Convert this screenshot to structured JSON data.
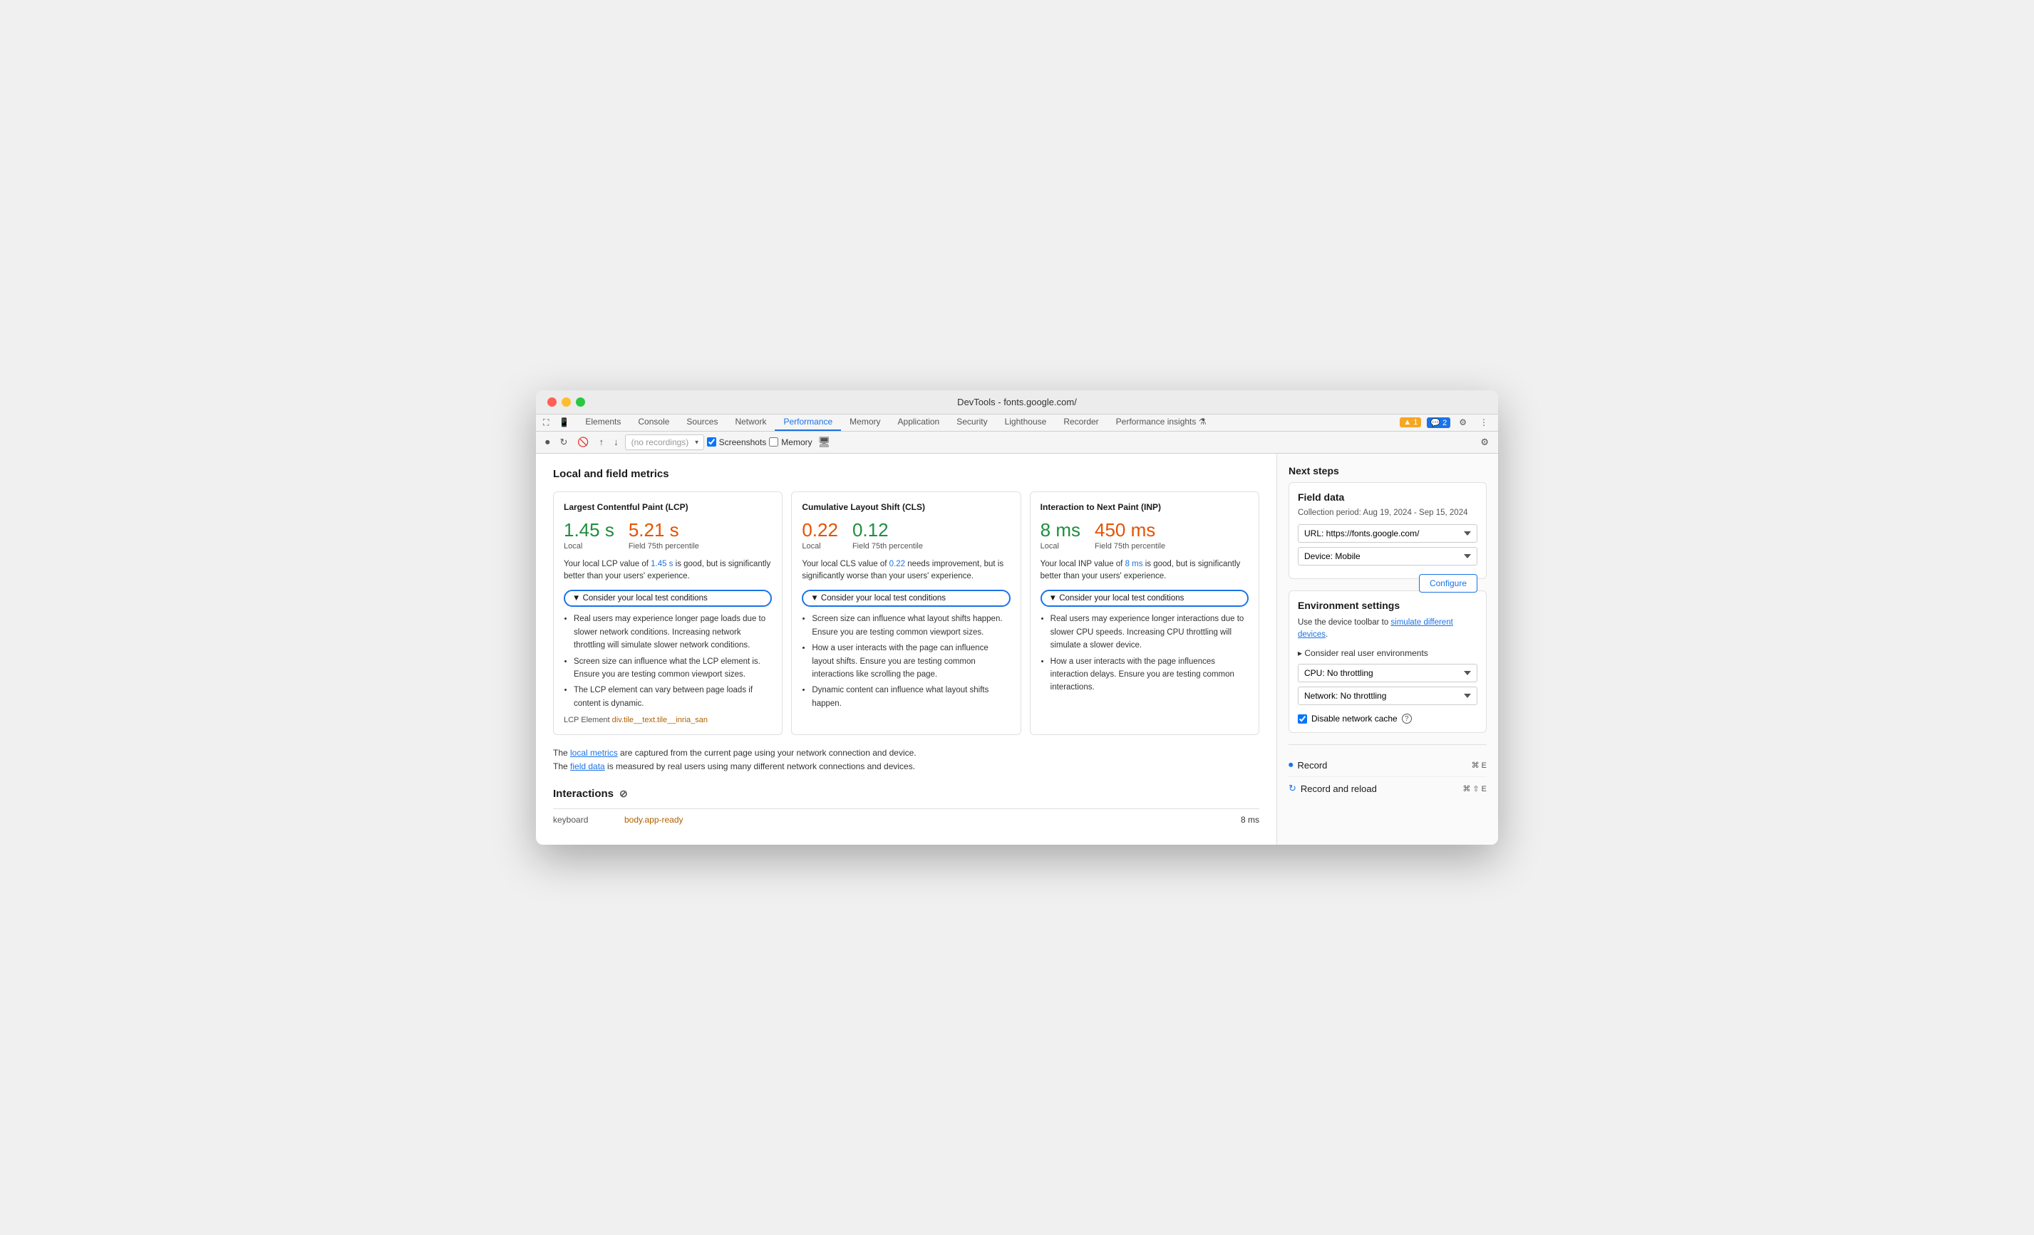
{
  "window": {
    "title": "DevTools - fonts.google.com/"
  },
  "tabs": {
    "items": [
      {
        "label": "Elements",
        "active": false
      },
      {
        "label": "Console",
        "active": false
      },
      {
        "label": "Sources",
        "active": false
      },
      {
        "label": "Network",
        "active": false
      },
      {
        "label": "Performance",
        "active": true
      },
      {
        "label": "Memory",
        "active": false
      },
      {
        "label": "Application",
        "active": false
      },
      {
        "label": "Security",
        "active": false
      },
      {
        "label": "Lighthouse",
        "active": false
      },
      {
        "label": "Recorder",
        "active": false
      },
      {
        "label": "Performance insights ⚗",
        "active": false
      }
    ],
    "alerts_label": "▲ 1",
    "info_label": "💬 2"
  },
  "toolbar2": {
    "recording_placeholder": "(no recordings)",
    "screenshots_label": "Screenshots",
    "memory_label": "Memory"
  },
  "main": {
    "section_title": "Local and field metrics",
    "lcp": {
      "title": "Largest Contentful Paint (LCP)",
      "local_value": "1.45 s",
      "local_label": "Local",
      "field_value": "5.21 s",
      "field_label": "Field 75th percentile",
      "description": "Your local LCP value of 1.45 s is good, but is significantly better than your users' experience.",
      "local_value_colored": "1.45 s",
      "description_text1": "Your local LCP value of ",
      "description_link": "1.45 s",
      "description_text2": " is good, but is significantly better than your users' experience.",
      "consider_label": "▼ Consider your local test conditions",
      "bullets": [
        "Real users may experience longer page loads due to slower network conditions. Increasing network throttling will simulate slower network conditions.",
        "Screen size can influence what the LCP element is. Ensure you are testing common viewport sizes.",
        "The LCP element can vary between page loads if content is dynamic."
      ],
      "lcp_element_label": "LCP Element",
      "lcp_element_value": "div.tile__text.tile__inria_san"
    },
    "cls": {
      "title": "Cumulative Layout Shift (CLS)",
      "local_value": "0.22",
      "local_label": "Local",
      "field_value": "0.12",
      "field_label": "Field 75th percentile",
      "description_text1": "Your local CLS value of ",
      "description_link": "0.22",
      "description_text2": " needs improvement, but is significantly worse than your users' experience.",
      "consider_label": "▼ Consider your local test conditions",
      "bullets": [
        "Screen size can influence what layout shifts happen. Ensure you are testing common viewport sizes.",
        "How a user interacts with the page can influence layout shifts. Ensure you are testing common interactions like scrolling the page.",
        "Dynamic content can influence what layout shifts happen."
      ]
    },
    "inp": {
      "title": "Interaction to Next Paint (INP)",
      "local_value": "8 ms",
      "local_label": "Local",
      "field_value": "450 ms",
      "field_label": "Field 75th percentile",
      "description_text1": "Your local INP value of ",
      "description_link": "8 ms",
      "description_text2": " is good, but is significantly better than your users' experience.",
      "consider_label": "▼ Consider your local test conditions",
      "bullets": [
        "Real users may experience longer interactions due to slower CPU speeds. Increasing CPU throttling will simulate a slower device.",
        "How a user interacts with the page influences interaction delays. Ensure you are testing common interactions."
      ]
    },
    "footer_text1": "The ",
    "footer_link1": "local metrics",
    "footer_text2": " are captured from the current page using your network connection and device.",
    "footer_text3": "The ",
    "footer_link2": "field data",
    "footer_text4": " is measured by real users using many different network connections and devices.",
    "interactions_title": "Interactions",
    "interactions": [
      {
        "type": "keyboard",
        "selector": "body.app-ready",
        "time": "8 ms"
      }
    ]
  },
  "right_panel": {
    "title": "Next steps",
    "field_data": {
      "title": "Field data",
      "collection_period": "Collection period: Aug 19, 2024 - Sep 15, 2024",
      "url_label": "URL: https://fonts.google.com/",
      "device_label": "Device: Mobile",
      "configure_label": "Configure"
    },
    "env_settings": {
      "title": "Environment settings",
      "description_text": "Use the device toolbar to ",
      "description_link": "simulate different devices",
      "description_text2": ".",
      "consider_label": "▸ Consider real user environments",
      "cpu_label": "CPU: No throttling",
      "network_label": "Network: No throttling",
      "disable_cache_label": "Disable network cache"
    },
    "record": {
      "label": "Record",
      "shortcut": "⌘ E",
      "reload_label": "Record and reload",
      "reload_shortcut": "⌘ ⇧ E"
    }
  },
  "colors": {
    "green": "#1e8e3e",
    "orange": "#e65100",
    "blue": "#1a73e8",
    "border_blue": "#1a73e8"
  }
}
